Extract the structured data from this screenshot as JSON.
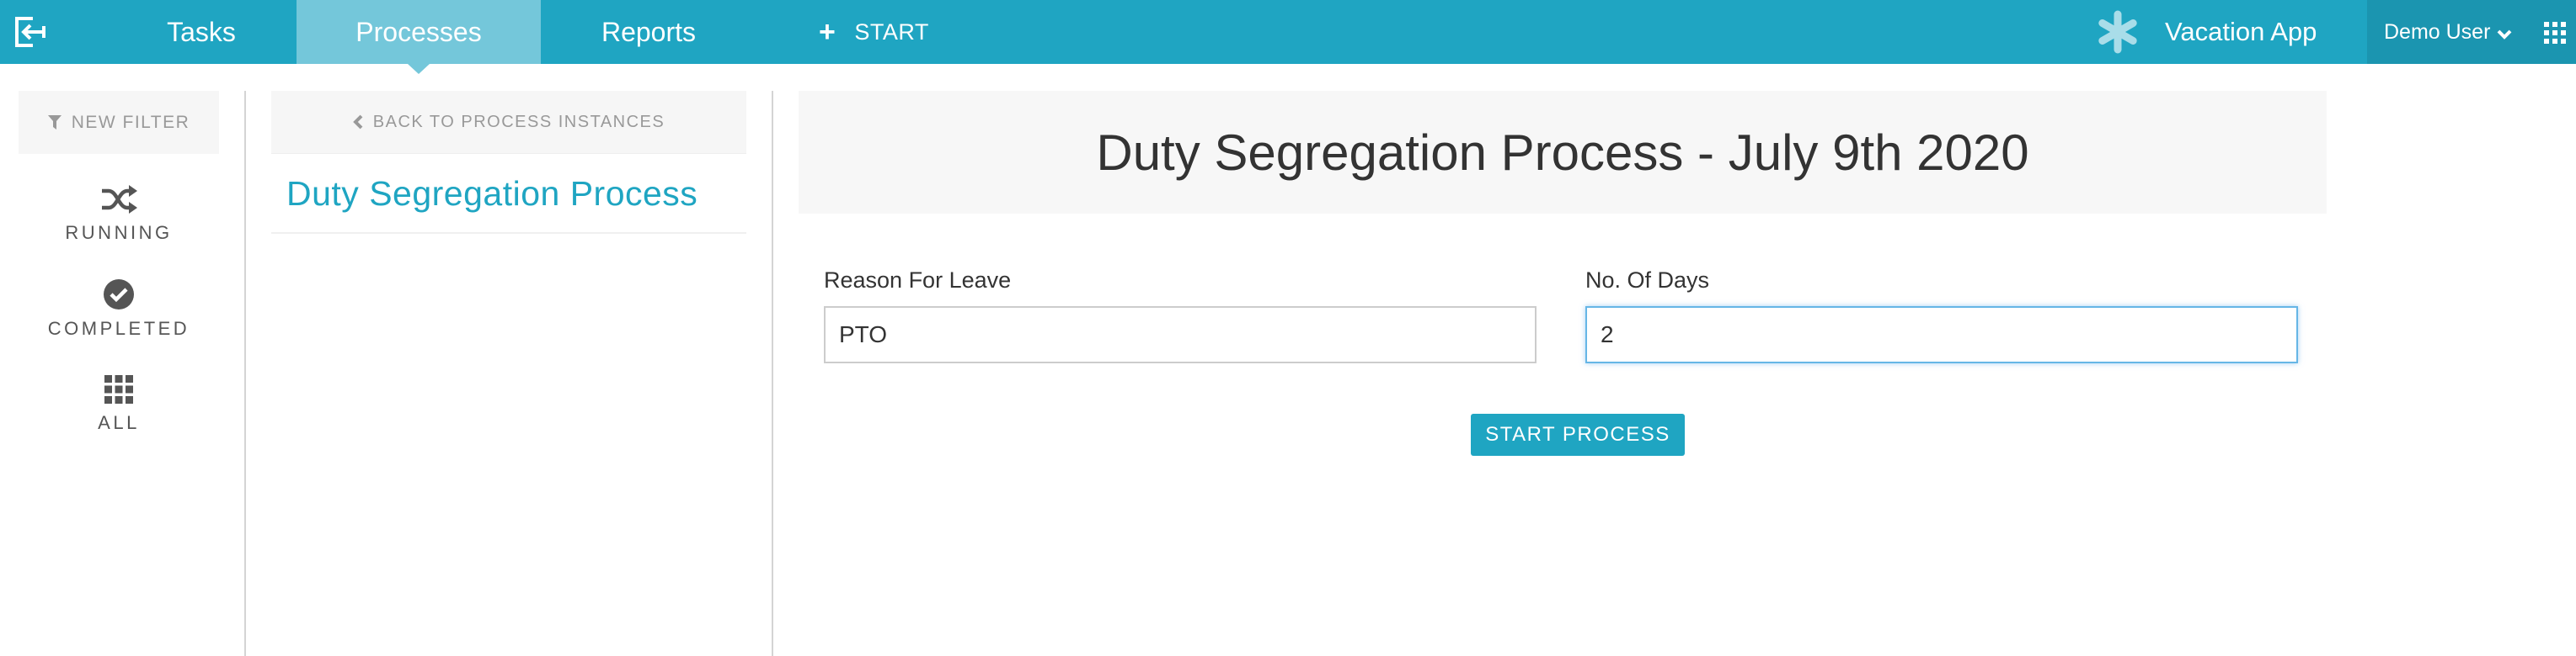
{
  "topbar": {
    "tabs": [
      {
        "label": "Tasks",
        "active": false
      },
      {
        "label": "Processes",
        "active": true
      },
      {
        "label": "Reports",
        "active": false
      }
    ],
    "start_label": "START",
    "app_name": "Vacation App",
    "user_name": "Demo User"
  },
  "filters": {
    "new_filter_label": "NEW FILTER",
    "items": [
      {
        "label": "RUNNING",
        "icon": "shuffle-icon"
      },
      {
        "label": "COMPLETED",
        "icon": "check-circle-icon"
      },
      {
        "label": "ALL",
        "icon": "grid-icon"
      }
    ]
  },
  "process_list": {
    "back_label": "BACK TO PROCESS INSTANCES",
    "selected_process": "Duty Segregation Process"
  },
  "form": {
    "title": "Duty Segregation Process - July 9th 2020",
    "fields": [
      {
        "label": "Reason For Leave",
        "value": "PTO"
      },
      {
        "label": "No. Of Days",
        "value": "2"
      }
    ],
    "submit_label": "START PROCESS"
  },
  "colors": {
    "brand": "#1fa5c2",
    "active_tab": "#74c7da",
    "user_area": "#1b95b0"
  }
}
